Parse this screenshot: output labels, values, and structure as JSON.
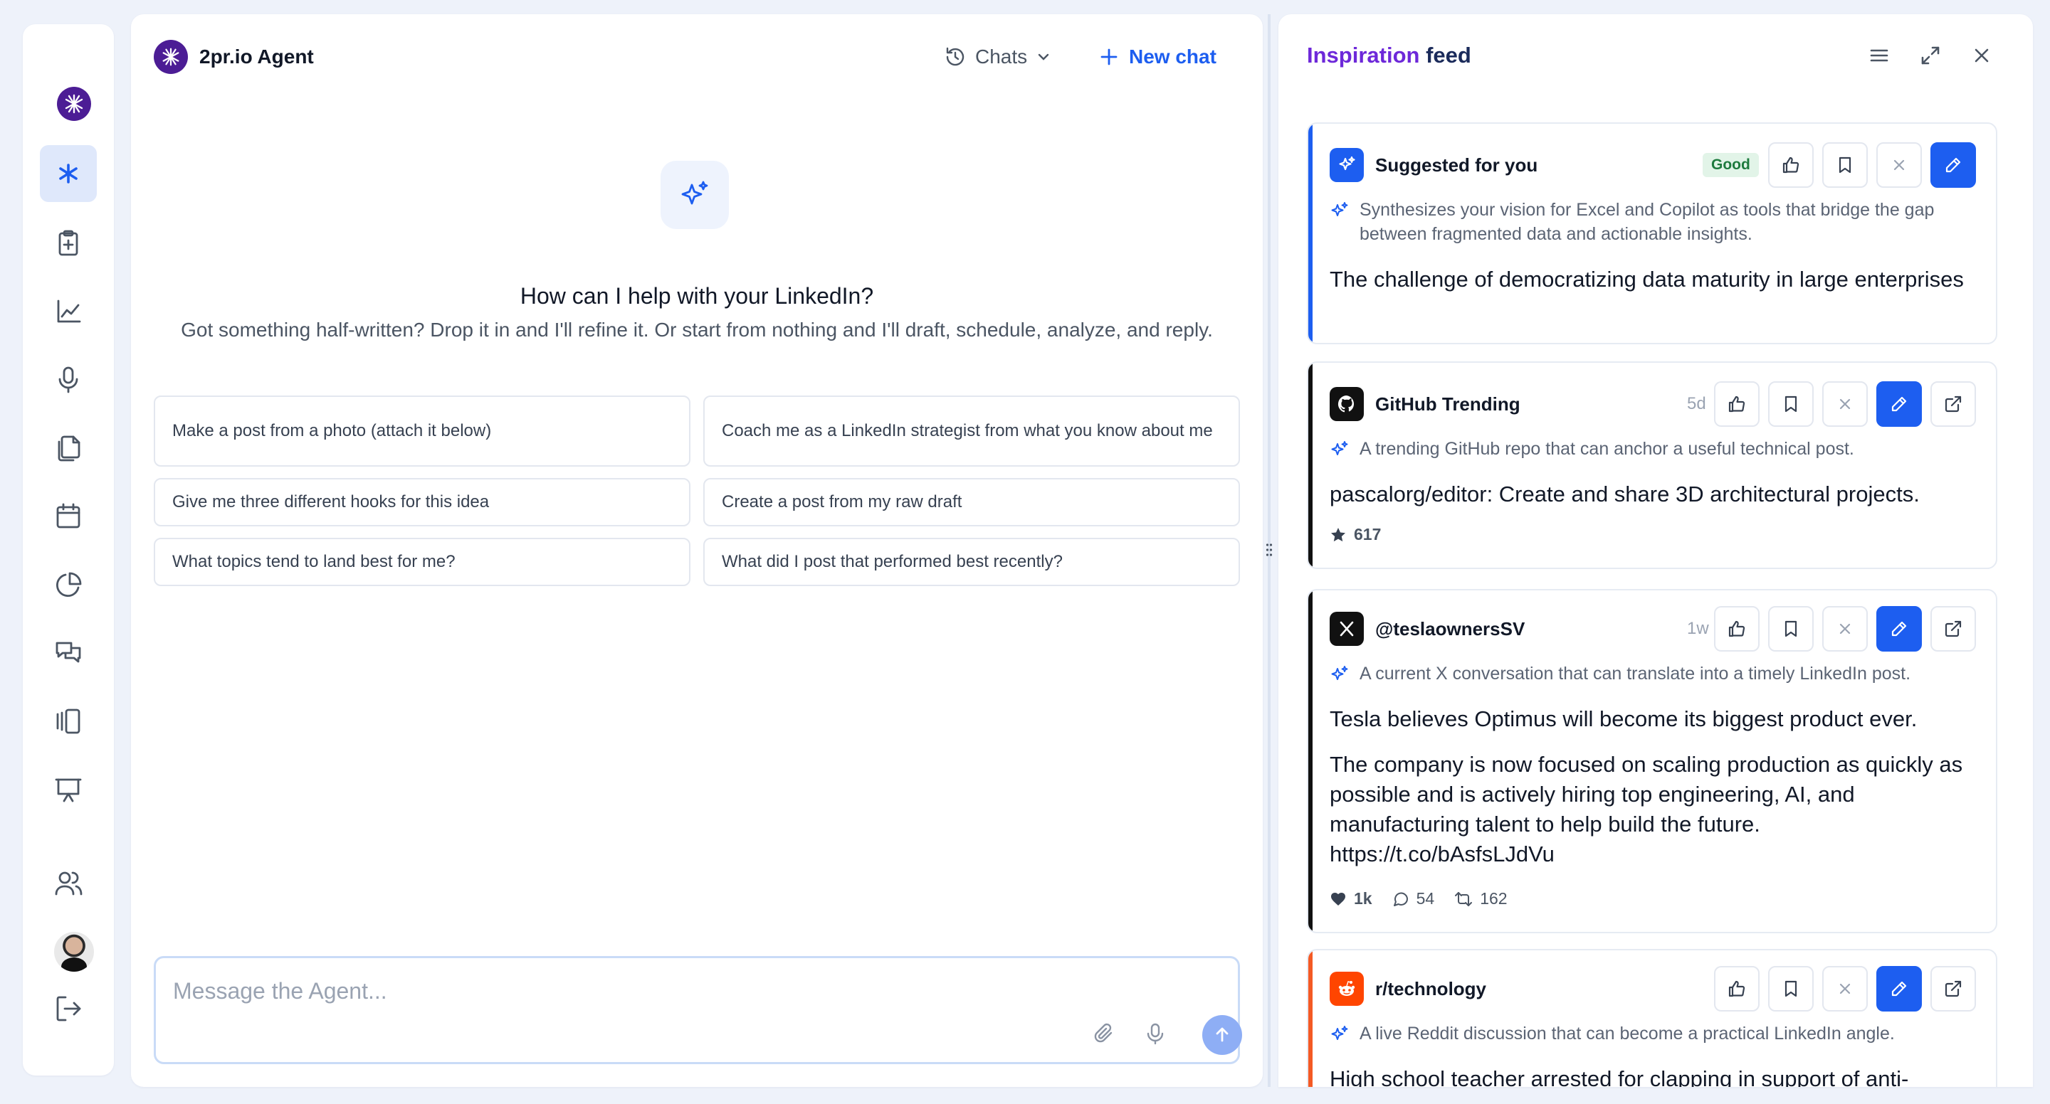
{
  "app": {
    "name": "2pr.io Agent",
    "chats_label": "Chats",
    "new_chat_label": "New chat"
  },
  "sidebar": {
    "items": [
      {
        "icon": "agent-icon",
        "active": true
      },
      {
        "icon": "clipboard-plus-icon"
      },
      {
        "icon": "line-chart-icon"
      },
      {
        "icon": "microphone-icon"
      },
      {
        "icon": "documents-icon"
      },
      {
        "icon": "calendar-icon"
      },
      {
        "icon": "pie-chart-icon"
      },
      {
        "icon": "messages-icon"
      },
      {
        "icon": "carousel-icon"
      },
      {
        "icon": "presentation-icon"
      },
      {
        "icon": "users-icon"
      },
      {
        "icon": "avatar"
      },
      {
        "icon": "logout-icon"
      }
    ]
  },
  "agent": {
    "heading": "How can I help with your LinkedIn?",
    "subheading": "Got something half-written? Drop it in and I'll refine it. Or start from nothing and I'll draft, schedule, analyze, and reply.",
    "suggestions": [
      "Make a post from a photo (attach it below)",
      "Coach me as a LinkedIn strategist from what you know about me",
      "Give me three different hooks for this idea",
      "Create a post from my raw draft",
      "What topics tend to land best for me?",
      "What did I post that performed best recently?"
    ],
    "composer": {
      "placeholder": "Message the Agent...",
      "value": ""
    }
  },
  "feed": {
    "title_part1": "Inspiration",
    "title_part2": "feed",
    "cards": [
      {
        "source": "Suggested for you",
        "badge": "Good",
        "reason": "Synthesizes your vision for Excel and Copilot as tools that bridge the gap between fragmented data and actionable insights.",
        "title": "The challenge of democratizing data maturity in large enterprises",
        "accent": "#1d5ef0"
      },
      {
        "source": "GitHub Trending",
        "age": "5d",
        "reason": "A trending GitHub repo that can anchor a useful technical post.",
        "title": "pascalorg/editor: Create and share 3D architectural projects.",
        "stars": "617",
        "accent": "#111111"
      },
      {
        "source": "@teslaownersSV",
        "age": "1w",
        "reason": "A current X conversation that can translate into a timely LinkedIn post.",
        "title": "Tesla believes Optimus will become its biggest product ever.",
        "body": "The company is now focused on scaling production as quickly as possible and is actively hiring top engineering, AI, and manufacturing talent to help build the future. https://t.co/bAsfsLJdVu",
        "likes": "1k",
        "comments": "54",
        "reposts": "162",
        "accent": "#111111"
      },
      {
        "source": "r/technology",
        "reason": "A live Reddit discussion that can become a practical LinkedIn angle.",
        "title": "High school teacher arrested for clapping in support of anti-",
        "accent": "#f45a24"
      }
    ]
  },
  "colors": {
    "primary": "#1d5ef0",
    "brand_purple": "#4c1d95",
    "reddit_orange": "#ff4500"
  }
}
